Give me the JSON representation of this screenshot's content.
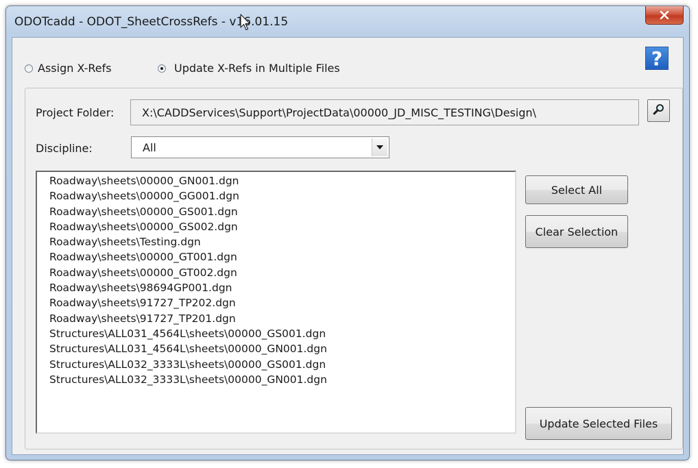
{
  "window": {
    "title": "ODOTcadd - ODOT_SheetCrossRefs - v16.01.15",
    "close_icon": "close-x-icon"
  },
  "mode": {
    "options": [
      {
        "label": "Assign X-Refs",
        "checked": false
      },
      {
        "label": "Update X-Refs in Multiple Files",
        "checked": true
      }
    ],
    "help_label": "?"
  },
  "project": {
    "folder_label": "Project Folder:",
    "folder_value": "X:\\CADDServices\\Support\\ProjectData\\00000_JD_MISC_TESTING\\Design\\",
    "browse_icon": "magnifier-icon"
  },
  "discipline": {
    "label": "Discipline:",
    "selected": "All"
  },
  "files": [
    "Roadway\\sheets\\00000_GN001.dgn",
    "Roadway\\sheets\\00000_GG001.dgn",
    "Roadway\\sheets\\00000_GS001.dgn",
    "Roadway\\sheets\\00000_GS002.dgn",
    "Roadway\\sheets\\Testing.dgn",
    "Roadway\\sheets\\00000_GT001.dgn",
    "Roadway\\sheets\\00000_GT002.dgn",
    "Roadway\\sheets\\98694GP001.dgn",
    "Roadway\\sheets\\91727_TP202.dgn",
    "Roadway\\sheets\\91727_TP201.dgn",
    "Structures\\ALL031_4564L\\sheets\\00000_GS001.dgn",
    "Structures\\ALL031_4564L\\sheets\\00000_GN001.dgn",
    "Structures\\ALL032_3333L\\sheets\\00000_GS001.dgn",
    "Structures\\ALL032_3333L\\sheets\\00000_GN001.dgn"
  ],
  "buttons": {
    "select_all": "Select All",
    "clear_selection": "Clear Selection",
    "update_selected": "Update Selected Files"
  }
}
